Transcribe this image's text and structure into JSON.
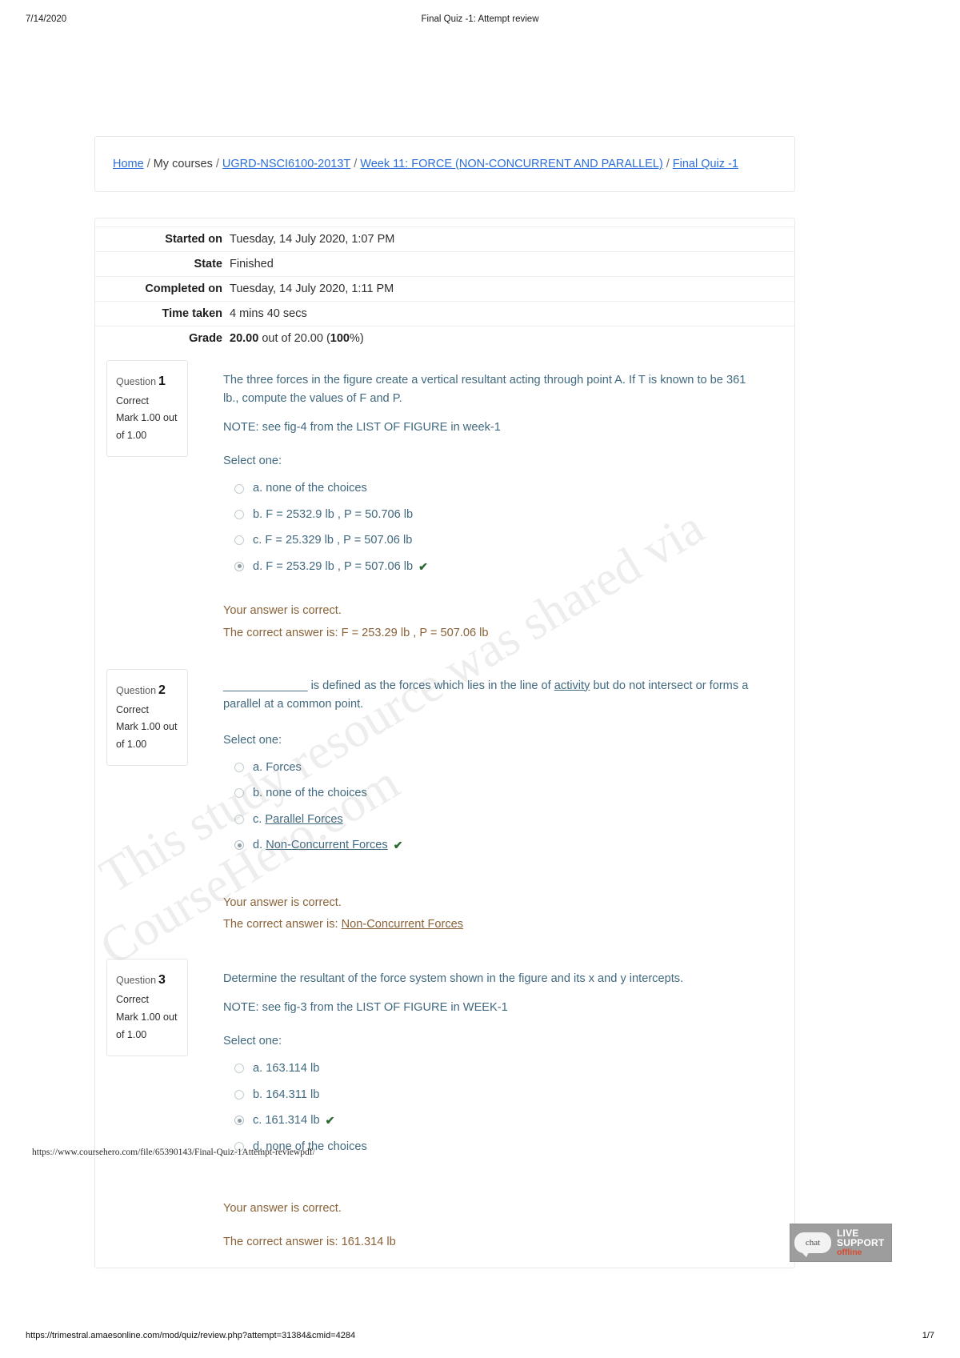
{
  "print": {
    "date": "7/14/2020",
    "title": "Final Quiz -1: Attempt review",
    "footer_url": "https://trimestral.amaesonline.com/mod/quiz/review.php?attempt=31384&cmid=4284",
    "page_number": "1/7"
  },
  "breadcrumb": {
    "items": [
      {
        "label": "Home",
        "link": true
      },
      {
        "label": "My courses",
        "link": false
      },
      {
        "label": "UGRD-NSCI6100-2013T",
        "link": true
      },
      {
        "label": "Week 11: FORCE (NON-CONCURRENT AND PARALLEL)",
        "link": true
      },
      {
        "label": "Final Quiz -1",
        "link": true
      }
    ],
    "separator": "/"
  },
  "summary": {
    "rows": [
      {
        "label": "Started on",
        "value": "Tuesday, 14 July 2020, 1:07 PM"
      },
      {
        "label": "State",
        "value": "Finished"
      },
      {
        "label": "Completed on",
        "value": "Tuesday, 14 July 2020, 1:11 PM"
      },
      {
        "label": "Time taken",
        "value": "4 mins 40 secs"
      }
    ],
    "grade": {
      "label": "Grade",
      "score": "20.00",
      "mid": " out of 20.00 (",
      "percent": "100",
      "tail": "%)"
    }
  },
  "questions": [
    {
      "label": "Question",
      "number": "1",
      "state": "Correct",
      "mark": "Mark 1.00 out of 1.00",
      "text": "The three forces in the figure create a vertical resultant acting through point A. If T is known to be 361 lb., compute the values of F and P.",
      "note": "NOTE: see fig-4 from the LIST OF FIGURE in week-1",
      "prompt": "Select one:",
      "answers": [
        {
          "text": "a. none of the choices",
          "selected": false,
          "correct": false,
          "underline": false
        },
        {
          "text": "b. F = 2532.9 lb , P = 50.706 lb",
          "selected": false,
          "correct": false,
          "underline": false
        },
        {
          "text": "c. F = 25.329 lb , P = 507.06 lb",
          "selected": false,
          "correct": false,
          "underline": false
        },
        {
          "text": "d. F = 253.29 lb , P = 507.06 lb",
          "selected": true,
          "correct": true,
          "underline": false
        }
      ],
      "feedback_result": "Your answer is correct.",
      "feedback_correct_prefix": "The correct answer is: ",
      "feedback_correct_answer": "F = 253.29 lb , P = 507.06 lb",
      "feedback_correct_underline": false
    },
    {
      "label": "Question",
      "number": "2",
      "state": "Correct",
      "mark": "Mark 1.00 out of 1.00",
      "text_pre": "_____________ is defined as the forces which lies in the line of ",
      "text_underline": "activity",
      "text_post": " but do not intersect or forms a parallel at a common point.",
      "note": "",
      "prompt": "Select one:",
      "answers": [
        {
          "text": "a. Forces",
          "selected": false,
          "correct": false,
          "underline": false
        },
        {
          "text": "b. none of the choices",
          "selected": false,
          "correct": false,
          "underline": false
        },
        {
          "text": "c. Parallel Forces",
          "selected": false,
          "correct": false,
          "underline": true,
          "prefix": "c. ",
          "body": "Parallel Forces"
        },
        {
          "text": "d. Non-Concurrent Forces",
          "selected": true,
          "correct": true,
          "underline": true,
          "prefix": "d. ",
          "body": "Non-Concurrent Forces"
        }
      ],
      "feedback_result": "Your answer is correct.",
      "feedback_correct_prefix": "The correct answer is: ",
      "feedback_correct_answer": "Non-Concurrent Forces",
      "feedback_correct_underline": true
    },
    {
      "label": "Question",
      "number": "3",
      "state": "Correct",
      "mark": "Mark 1.00 out of 1.00",
      "text": "Determine the resultant of the force system shown in the figure and its x and y intercepts.",
      "note": "NOTE: see fig-3 from the LIST OF FIGURE in WEEK-1",
      "prompt": "Select one:",
      "answers": [
        {
          "text": "a. 163.114 lb",
          "selected": false,
          "correct": false,
          "underline": false
        },
        {
          "text": "b. 164.311 lb",
          "selected": false,
          "correct": false,
          "underline": false
        },
        {
          "text": "c. 161.314 lb",
          "selected": true,
          "correct": true,
          "underline": false
        },
        {
          "text": "d. none of the choices",
          "selected": false,
          "correct": false,
          "underline": false
        }
      ],
      "feedback_result": "Your answer is correct.",
      "feedback_correct_prefix": "The correct answer is: ",
      "feedback_correct_answer": "161.314 lb",
      "feedback_correct_underline": false
    }
  ],
  "watermarks": {
    "line1": "This study resource was shared via",
    "line2": "CourseHero.com",
    "source_url": "https://www.coursehero.com/file/65390143/Final-Quiz-1Attempt-reviewpdf/"
  },
  "chat_widget": {
    "bubble_label": "chat",
    "line1": "LIVE",
    "line2": "SUPPORT",
    "line3": "offline"
  },
  "icons": {
    "correct_tick": "✔"
  }
}
